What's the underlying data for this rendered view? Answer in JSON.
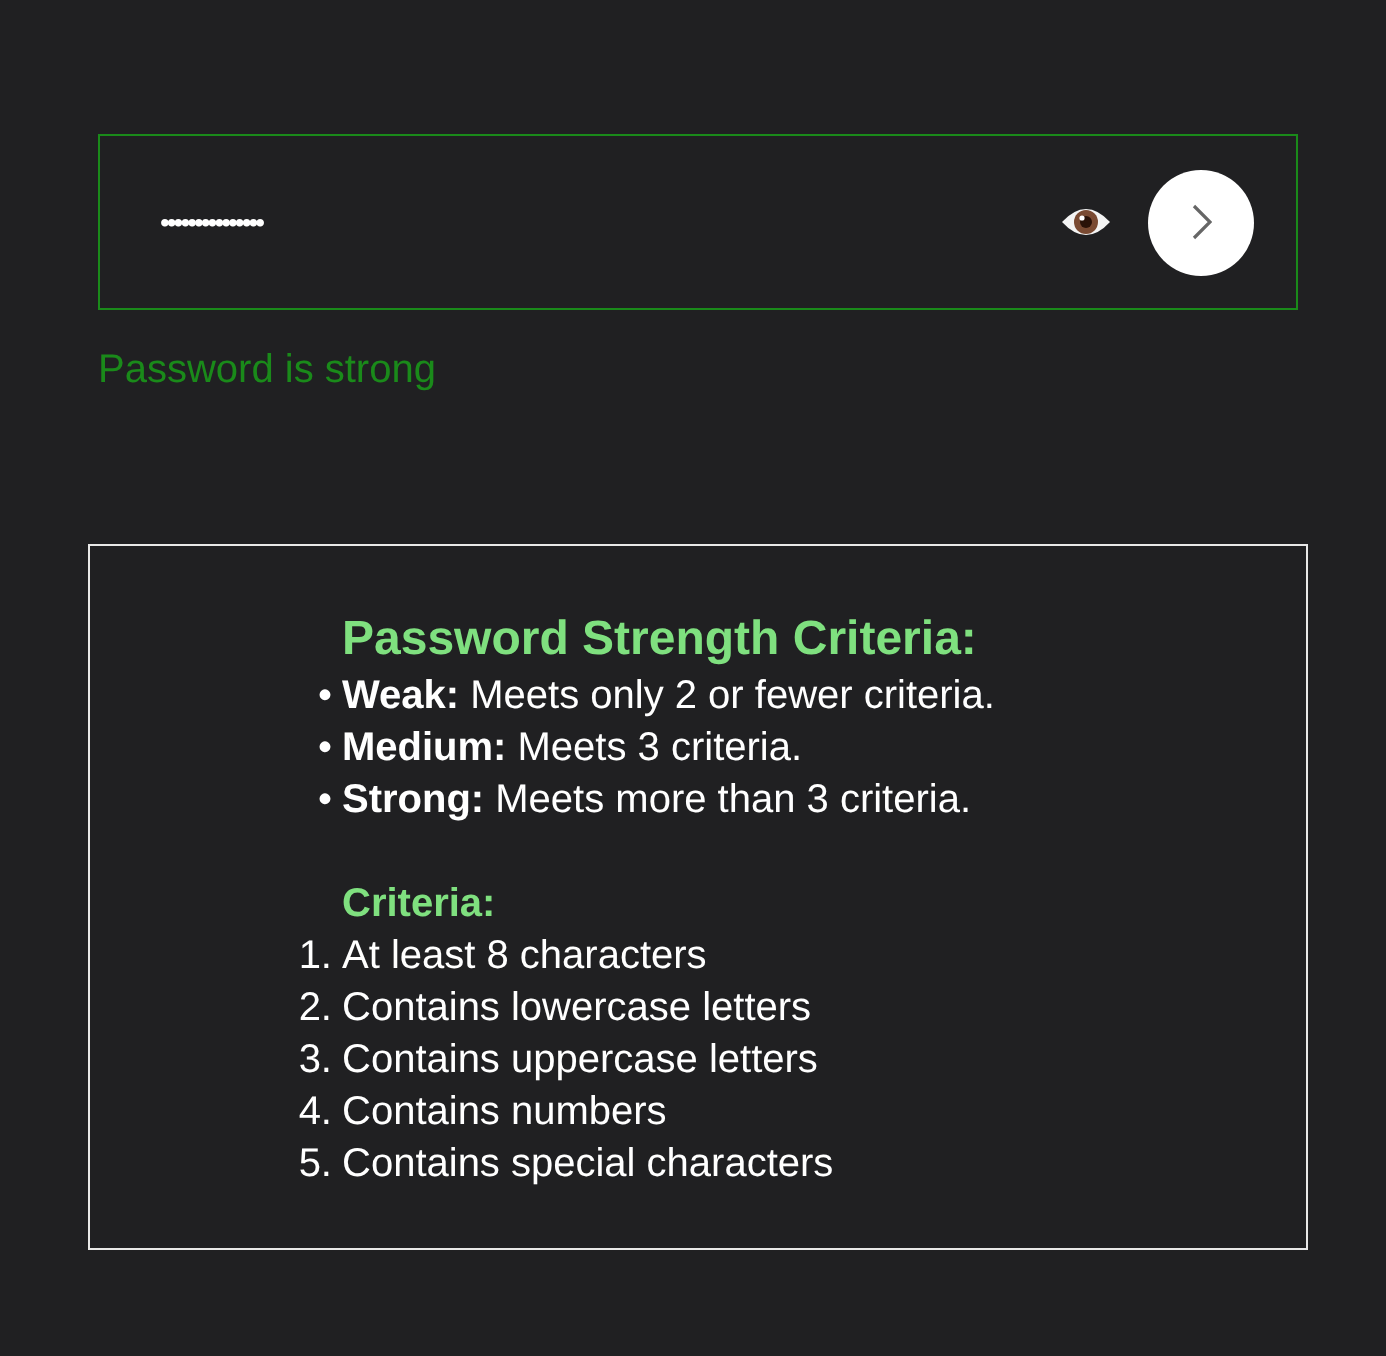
{
  "password_field": {
    "value": "•••••••••••••••",
    "valid": true
  },
  "strength_message": "Password is strong",
  "criteria_panel": {
    "title": "Password Strength Criteria:",
    "levels": [
      {
        "marker": "•",
        "text": "**Weak:** Meets only 2 or fewer criteria."
      },
      {
        "marker": "•",
        "text": "**Medium:** Meets 3 criteria."
      },
      {
        "marker": "•",
        "text": "**Strong:** Meets more than 3 criteria."
      }
    ],
    "criteria_title": "Criteria:",
    "criteria": [
      {
        "marker": "1.",
        "text": "At least 8 characters"
      },
      {
        "marker": "2.",
        "text": "Contains lowercase letters"
      },
      {
        "marker": "3.",
        "text": "Contains uppercase letters"
      },
      {
        "marker": "4.",
        "text": "Contains numbers"
      },
      {
        "marker": "5.",
        "text": "Contains special characters"
      }
    ]
  }
}
